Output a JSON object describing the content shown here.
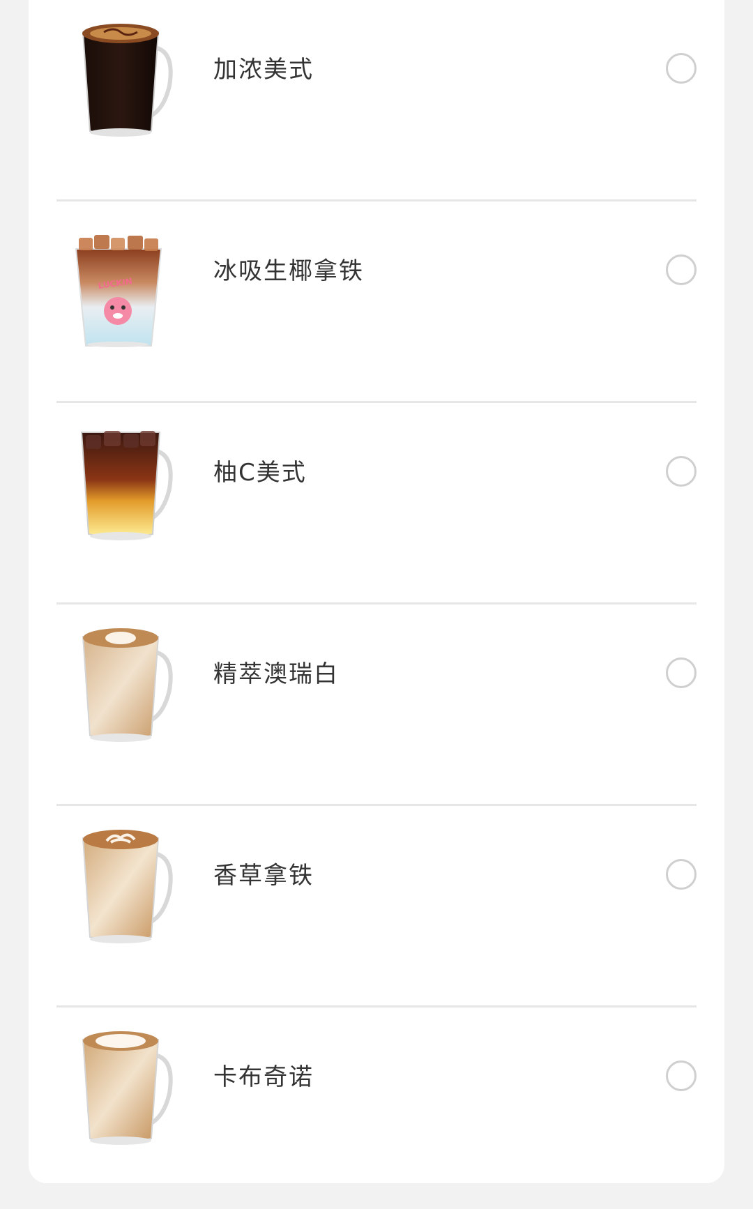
{
  "products": [
    {
      "name": "加浓美式",
      "icon": "americano-mug-icon"
    },
    {
      "name": "冰吸生椰拿铁",
      "icon": "iced-coconut-latte-cup-icon",
      "cup_print": "LUCKIN"
    },
    {
      "name": "柚C美式",
      "icon": "grapefruit-americano-mug-icon"
    },
    {
      "name": "精萃澳瑞白",
      "icon": "flat-white-mug-icon"
    },
    {
      "name": "香草拿铁",
      "icon": "vanilla-latte-mug-icon"
    },
    {
      "name": "卡布奇诺",
      "icon": "cappuccino-mug-icon"
    }
  ]
}
